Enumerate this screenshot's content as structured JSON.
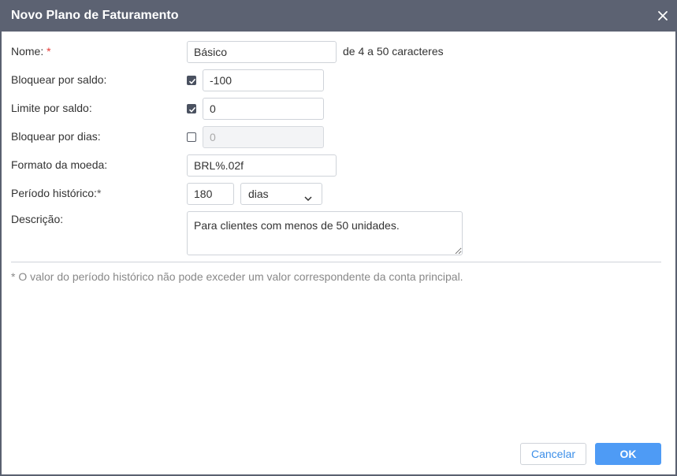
{
  "dialog": {
    "title": "Novo Plano de Faturamento",
    "close_icon": "close-icon"
  },
  "form": {
    "name": {
      "label": "Nome:",
      "required_marker": "*",
      "value": "Básico",
      "hint": "de 4 a 50 caracteres"
    },
    "block_by_balance": {
      "label": "Bloquear por saldo:",
      "checked": true,
      "value": "-100"
    },
    "limit_by_balance": {
      "label": "Limite por saldo:",
      "checked": true,
      "value": "0"
    },
    "block_by_days": {
      "label": "Bloquear por dias:",
      "checked": false,
      "value": "0",
      "disabled": true
    },
    "currency_format": {
      "label": "Formato da moeda:",
      "value": "BRL%.02f"
    },
    "history_period": {
      "label": "Período histórico:",
      "required_marker": "*",
      "value": "180",
      "unit": "dias"
    },
    "description": {
      "label": "Descrição:",
      "value": "Para clientes com menos de 50 unidades."
    }
  },
  "footnote": "* O valor do período histórico não pode exceder um valor correspondente da conta principal.",
  "buttons": {
    "cancel": "Cancelar",
    "ok": "OK"
  },
  "colors": {
    "titlebar": "#5c6272",
    "required_star": "#e53935",
    "primary_button": "#4e9bf5",
    "link_text": "#3b8ee8"
  }
}
